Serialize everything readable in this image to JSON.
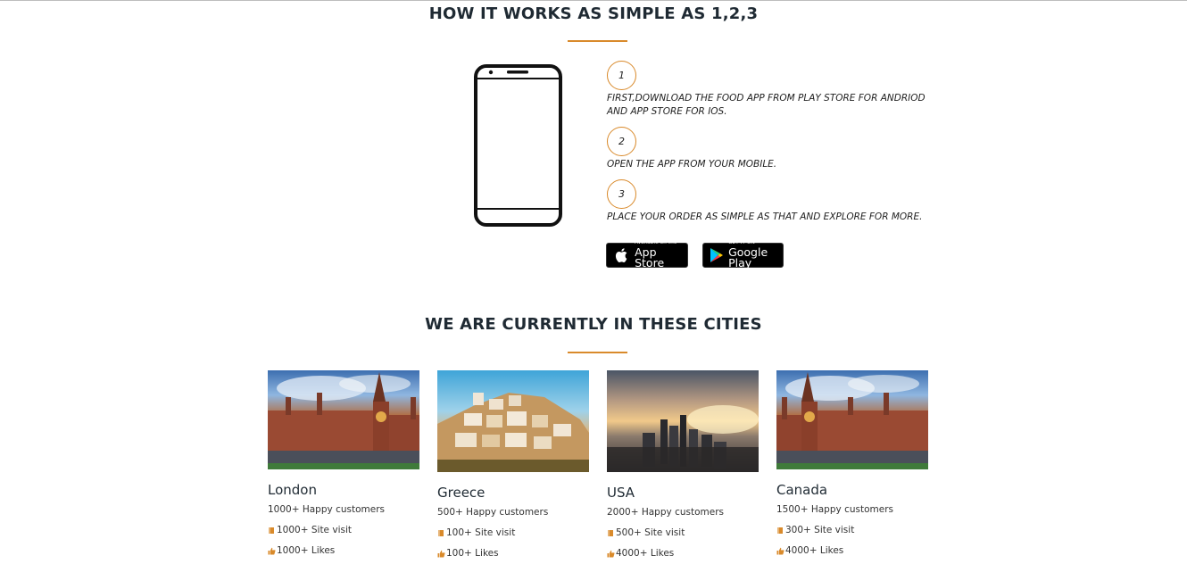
{
  "how_it_works": {
    "title": "HOW IT WORKS AS SIMPLE AS 1,2,3",
    "steps": [
      {
        "number": "1",
        "text": "FIRST,DOWNLOAD THE FOOD APP FROM PLAY STORE FOR ANDRIOD AND APP STORE FOR IOS."
      },
      {
        "number": "2",
        "text": "OPEN THE APP FROM YOUR MOBILE."
      },
      {
        "number": "3",
        "text": "PLACE YOUR ORDER AS SIMPLE AS THAT AND EXPLORE FOR MORE."
      }
    ],
    "app_store": {
      "small": "Available on the",
      "big": "App Store"
    },
    "google_play": {
      "small": "GET IT ON",
      "big": "Google Play"
    }
  },
  "cities": {
    "title": "WE ARE CURRENTLY IN THESE CITIES",
    "items": [
      {
        "name": "London",
        "customers": "1000+ Happy customers",
        "visits": "1000+ Site visit",
        "likes": "1000+ Likes"
      },
      {
        "name": "Greece",
        "customers": "500+ Happy customers",
        "visits": "100+ Site visit",
        "likes": "100+ Likes"
      },
      {
        "name": "USA",
        "customers": "2000+ Happy customers",
        "visits": "500+ Site visit",
        "likes": "4000+ Likes"
      },
      {
        "name": "Canada",
        "customers": "1500+ Happy customers",
        "visits": "300+ Site visit",
        "likes": "4000+ Likes"
      }
    ]
  },
  "colors": {
    "accent": "#d98a2b",
    "heading": "#1f2a33"
  },
  "icons": {
    "phone": "smartphone-icon",
    "apple": "apple-icon",
    "play": "google-play-icon",
    "visit": "book-icon",
    "like": "thumbs-up-icon"
  }
}
